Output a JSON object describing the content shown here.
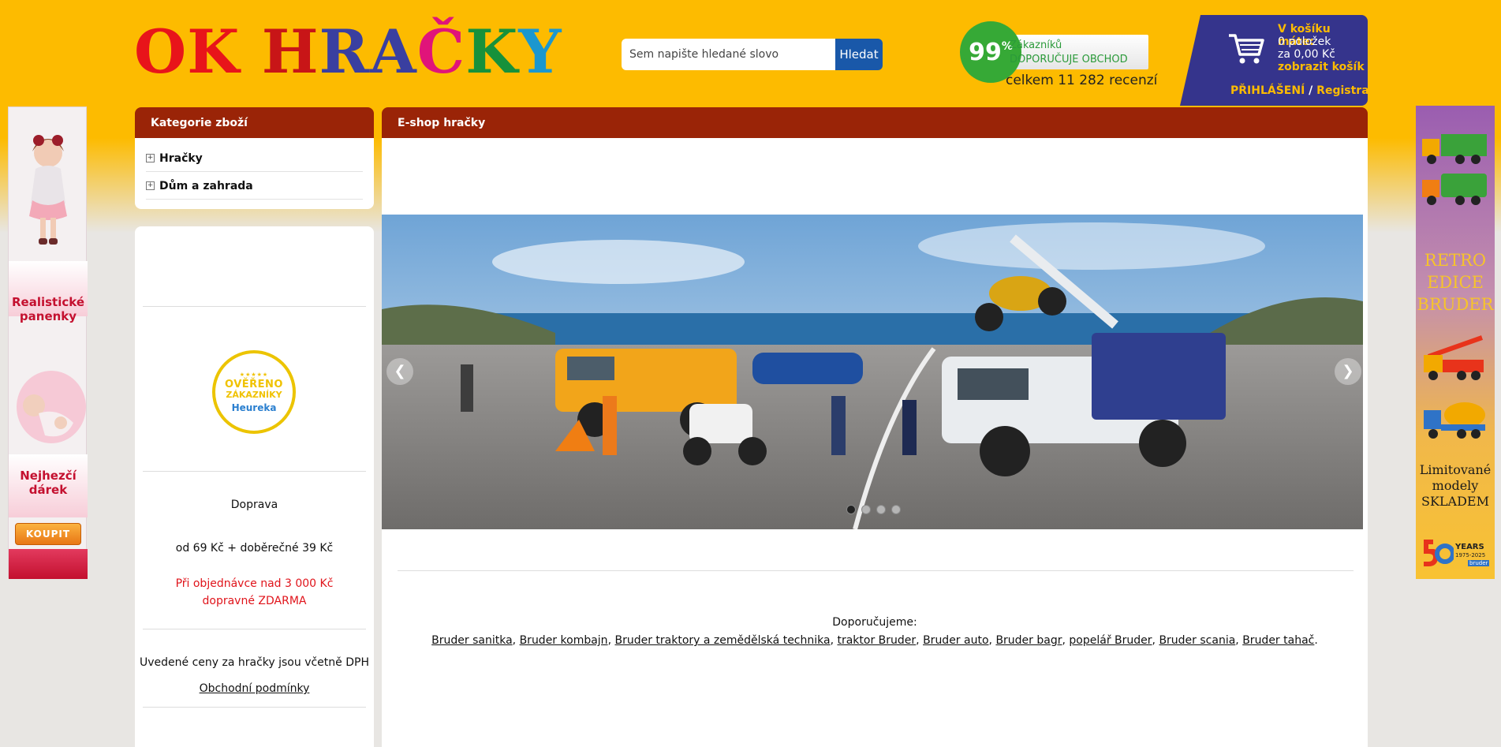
{
  "logo": {
    "letters": [
      {
        "ch": "O",
        "color": "#e8141a"
      },
      {
        "ch": "K",
        "color": "#e8141a"
      },
      {
        "ch": " ",
        "color": "#e8141a"
      },
      {
        "ch": "H",
        "color": "#c81517"
      },
      {
        "ch": "R",
        "color": "#3a3fa0"
      },
      {
        "ch": "A",
        "color": "#3a3fa0"
      },
      {
        "ch": "Č",
        "color": "#e0147a"
      },
      {
        "ch": "K",
        "color": "#17913b"
      },
      {
        "ch": "Y",
        "color": "#1b97cf"
      }
    ]
  },
  "search": {
    "placeholder": "Sem napište hledané slovo",
    "button_label": "Hledat"
  },
  "heureka_badge": {
    "percent": "99",
    "percent_sign": "%",
    "line1": "Zákazníků",
    "line2": "DOPORUČUJE OBCHOD",
    "total": "celkem 11 282 recenzí"
  },
  "cart": {
    "title": "V košíku máte:",
    "items": "0 položek",
    "price": "za 0,00 Kč",
    "show_link": "zobrazit košík",
    "login": "PŘIHLÁŠENÍ",
    "separator": "/",
    "register": "Registrace"
  },
  "left_banner": {
    "text1_a": "Realistické",
    "text1_b": "panenky",
    "text2_a": "Nejhezčí",
    "text2_b": "dárek",
    "button": "KOUPIT"
  },
  "right_banner": {
    "title_1": "RETRO",
    "title_2": "EDICE",
    "title_3": "BRUDER",
    "sub_1": "Limitované",
    "sub_2": "modely",
    "sub_3": "SKLADEM",
    "years": "YEARS",
    "years_range": "1975-2025",
    "brand": "bruder"
  },
  "categories": {
    "heading": "Kategorie zboží",
    "items": [
      "Hračky",
      "Dům a zahrada"
    ]
  },
  "info": {
    "seal_top": "OVĚŘENO",
    "seal_mid": "ZÁKAZNÍKY",
    "seal_brand": "Heureka",
    "shipping_title": "Doprava",
    "shipping_price": "od 69 Kč + doběrečné 39 Kč",
    "free_shipping_1": "Při objednávce nad 3 000 Kč",
    "free_shipping_2": "dopravné ZDARMA",
    "vat_note": "Uvedené ceny za hračky jsou včetně DPH",
    "terms_link": "Obchodní podmínky"
  },
  "main": {
    "heading": "E-shop hračky",
    "slider": {
      "slides": 4,
      "active": 0
    },
    "recommend_title": "Doporučujeme:",
    "recommend_links": [
      "Bruder sanitka",
      "Bruder kombajn",
      "Bruder traktory a zemědělská technika",
      "traktor Bruder",
      "Bruder auto",
      "Bruder bagr",
      "popelář Bruder",
      "Bruder scania",
      "Bruder tahač"
    ]
  },
  "colors": {
    "header_bg": "#fdbb00",
    "panel_head": "#9a2407",
    "cart_bg": "#35348c",
    "search_btn": "#1958a9",
    "accent_red": "#e0141b"
  }
}
